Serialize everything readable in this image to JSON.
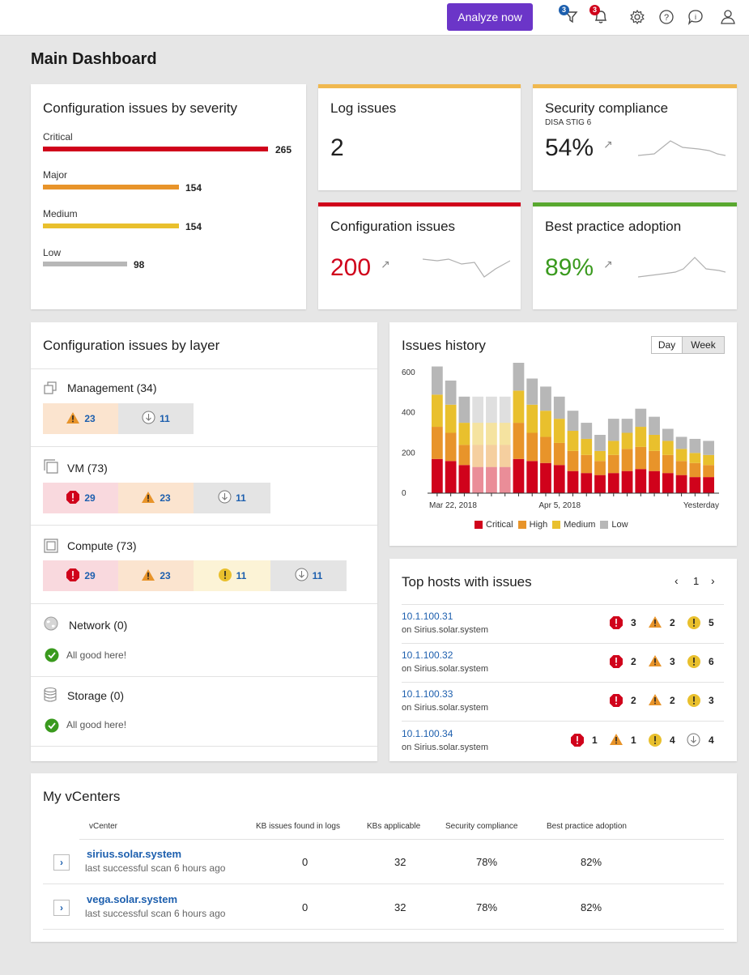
{
  "topbar": {
    "analyze_label": "Analyze now",
    "filter_badge": "3",
    "alerts_badge": "3",
    "accent": "#6b35c8"
  },
  "page_title": "Main Dashboard",
  "severity": {
    "title": "Configuration issues by severity",
    "items": [
      {
        "label": "Critical",
        "value": "265",
        "color": "#d0021b"
      },
      {
        "label": "Major",
        "value": "154",
        "color": "#e8942a"
      },
      {
        "label": "Medium",
        "value": "154",
        "color": "#e9c02d"
      },
      {
        "label": "Low",
        "value": "98",
        "color": "#b7b7b7"
      }
    ]
  },
  "log_issues": {
    "title": "Log issues",
    "value": "2",
    "strip_color": "#f0b84f"
  },
  "security": {
    "title": "Security compliance",
    "subtitle": "DISA STIG 6",
    "value": "54%",
    "trend": "↗",
    "strip_color": "#f0b84f"
  },
  "config_issues": {
    "title": "Configuration issues",
    "value": "200",
    "trend": "↗",
    "strip_color": "#d0021b",
    "value_color": "#d0021b"
  },
  "best_practice": {
    "title": "Best practice adoption",
    "value": "89%",
    "trend": "↗",
    "strip_color": "#59a82f",
    "value_color": "#3a9a1e"
  },
  "layers": {
    "title": "Configuration issues by layer",
    "groups": [
      {
        "name": "Management (34)",
        "cells": [
          {
            "kind": "major",
            "count": "23"
          },
          {
            "kind": "low",
            "count": "11"
          }
        ]
      },
      {
        "name": "VM (73)",
        "cells": [
          {
            "kind": "critical",
            "count": "29"
          },
          {
            "kind": "major",
            "count": "23"
          },
          {
            "kind": "low",
            "count": "11"
          }
        ]
      },
      {
        "name": "Compute (73)",
        "cells": [
          {
            "kind": "critical",
            "count": "29"
          },
          {
            "kind": "major",
            "count": "23"
          },
          {
            "kind": "medium",
            "count": "11"
          },
          {
            "kind": "low",
            "count": "11"
          }
        ]
      },
      {
        "name": "Network (0)",
        "good": "All good here!"
      },
      {
        "name": "Storage (0)",
        "good": "All good here!"
      }
    ]
  },
  "history": {
    "title": "Issues history",
    "toggle_day": "Day",
    "toggle_week": "Week"
  },
  "chart_data": {
    "type": "bar",
    "title": "Issues history",
    "stacked": true,
    "ylim": [
      0,
      600
    ],
    "y_ticks": [
      "600",
      "400",
      "200",
      "0"
    ],
    "x_tick_labels": [
      "Mar 22, 2018",
      "Apr 5, 2018",
      "Yesterday"
    ],
    "legend_position": "bottom",
    "series": [
      {
        "name": "Critical",
        "color": "#d0021b",
        "values": [
          170,
          160,
          140,
          130,
          130,
          130,
          170,
          160,
          150,
          140,
          110,
          100,
          90,
          100,
          110,
          120,
          110,
          100,
          90,
          80,
          80
        ]
      },
      {
        "name": "High",
        "color": "#e8942a",
        "values": [
          160,
          140,
          100,
          110,
          110,
          110,
          180,
          140,
          130,
          110,
          100,
          90,
          70,
          90,
          110,
          110,
          100,
          90,
          70,
          70,
          60
        ]
      },
      {
        "name": "Medium",
        "color": "#e9c02d",
        "values": [
          160,
          140,
          110,
          110,
          110,
          110,
          160,
          140,
          130,
          120,
          100,
          80,
          50,
          70,
          80,
          100,
          80,
          70,
          60,
          50,
          50
        ]
      },
      {
        "name": "Low",
        "color": "#b7b7b7",
        "values": [
          140,
          120,
          130,
          130,
          130,
          130,
          160,
          130,
          120,
          110,
          100,
          80,
          80,
          110,
          70,
          90,
          90,
          60,
          60,
          70,
          70
        ]
      }
    ],
    "faded_bars": [
      3,
      4,
      5
    ]
  },
  "hosts": {
    "title": "Top hosts with issues",
    "page": "1",
    "items": [
      {
        "ip": "10.1.100.31",
        "sub": "on Sirius.solar.system",
        "critical": "3",
        "major": "2",
        "medium": "5"
      },
      {
        "ip": "10.1.100.32",
        "sub": "on Sirius.solar.system",
        "critical": "2",
        "major": "3",
        "medium": "6"
      },
      {
        "ip": "10.1.100.33",
        "sub": "on Sirius.solar.system",
        "critical": "2",
        "major": "2",
        "medium": "3"
      },
      {
        "ip": "10.1.100.34",
        "sub": "on Sirius.solar.system",
        "critical": "1",
        "major": "1",
        "medium": "4",
        "low": "4"
      }
    ]
  },
  "vcenters": {
    "title": "My vCenters",
    "headers": [
      "vCenter",
      "KB issues found in logs",
      "KBs applicable",
      "Security compliance",
      "Best practice adoption"
    ],
    "rows": [
      {
        "name": "sirius.solar.system",
        "sub": "last successful scan 6 hours ago",
        "kb_logs": "0",
        "kb_applicable": "32",
        "security": "78%",
        "best_practice": "82%"
      },
      {
        "name": "vega.solar.system",
        "sub": "last successful scan 6 hours ago",
        "kb_logs": "0",
        "kb_applicable": "32",
        "security": "78%",
        "best_practice": "82%"
      }
    ]
  }
}
